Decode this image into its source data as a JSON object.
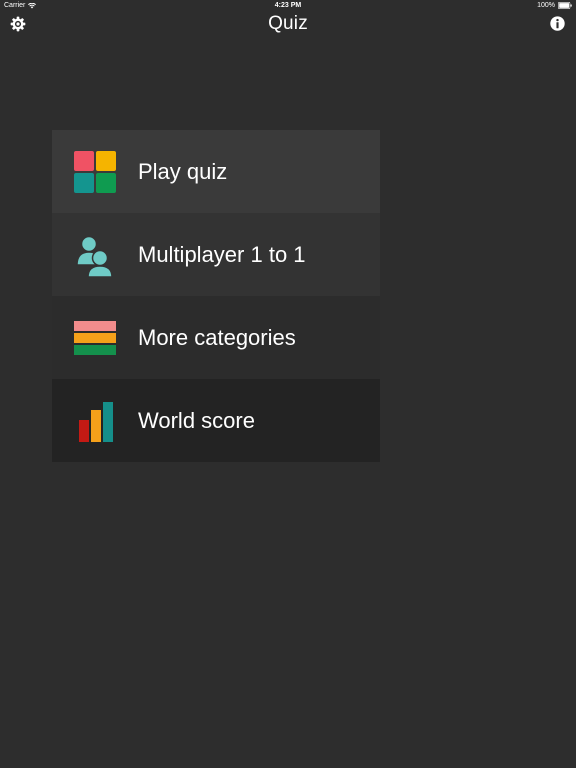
{
  "status_bar": {
    "carrier": "Carrier",
    "time": "4:23 PM",
    "battery": "100%"
  },
  "nav": {
    "title": "Quiz",
    "left_icon": "gear-icon",
    "right_icon": "info-icon"
  },
  "menu": {
    "items": [
      {
        "label": "Play quiz",
        "icon": "color-tiles-icon"
      },
      {
        "label": "Multiplayer 1 to 1",
        "icon": "two-users-icon"
      },
      {
        "label": "More categories",
        "icon": "stacked-layers-icon"
      },
      {
        "label": "World score",
        "icon": "bar-chart-icon"
      }
    ]
  },
  "colors": {
    "background": "#2d2d2d",
    "tile_red": "#f05264",
    "tile_yellow": "#f5b400",
    "tile_teal": "#14958f",
    "tile_green": "#0f9b50",
    "users_teal": "#6fcbc6",
    "layer_pink": "#f28c8c",
    "layer_orange": "#f6a11a",
    "layer_green": "#14904c",
    "bar_red": "#c41a14",
    "bar_orange": "#f5a01a",
    "bar_teal": "#158f8a"
  }
}
